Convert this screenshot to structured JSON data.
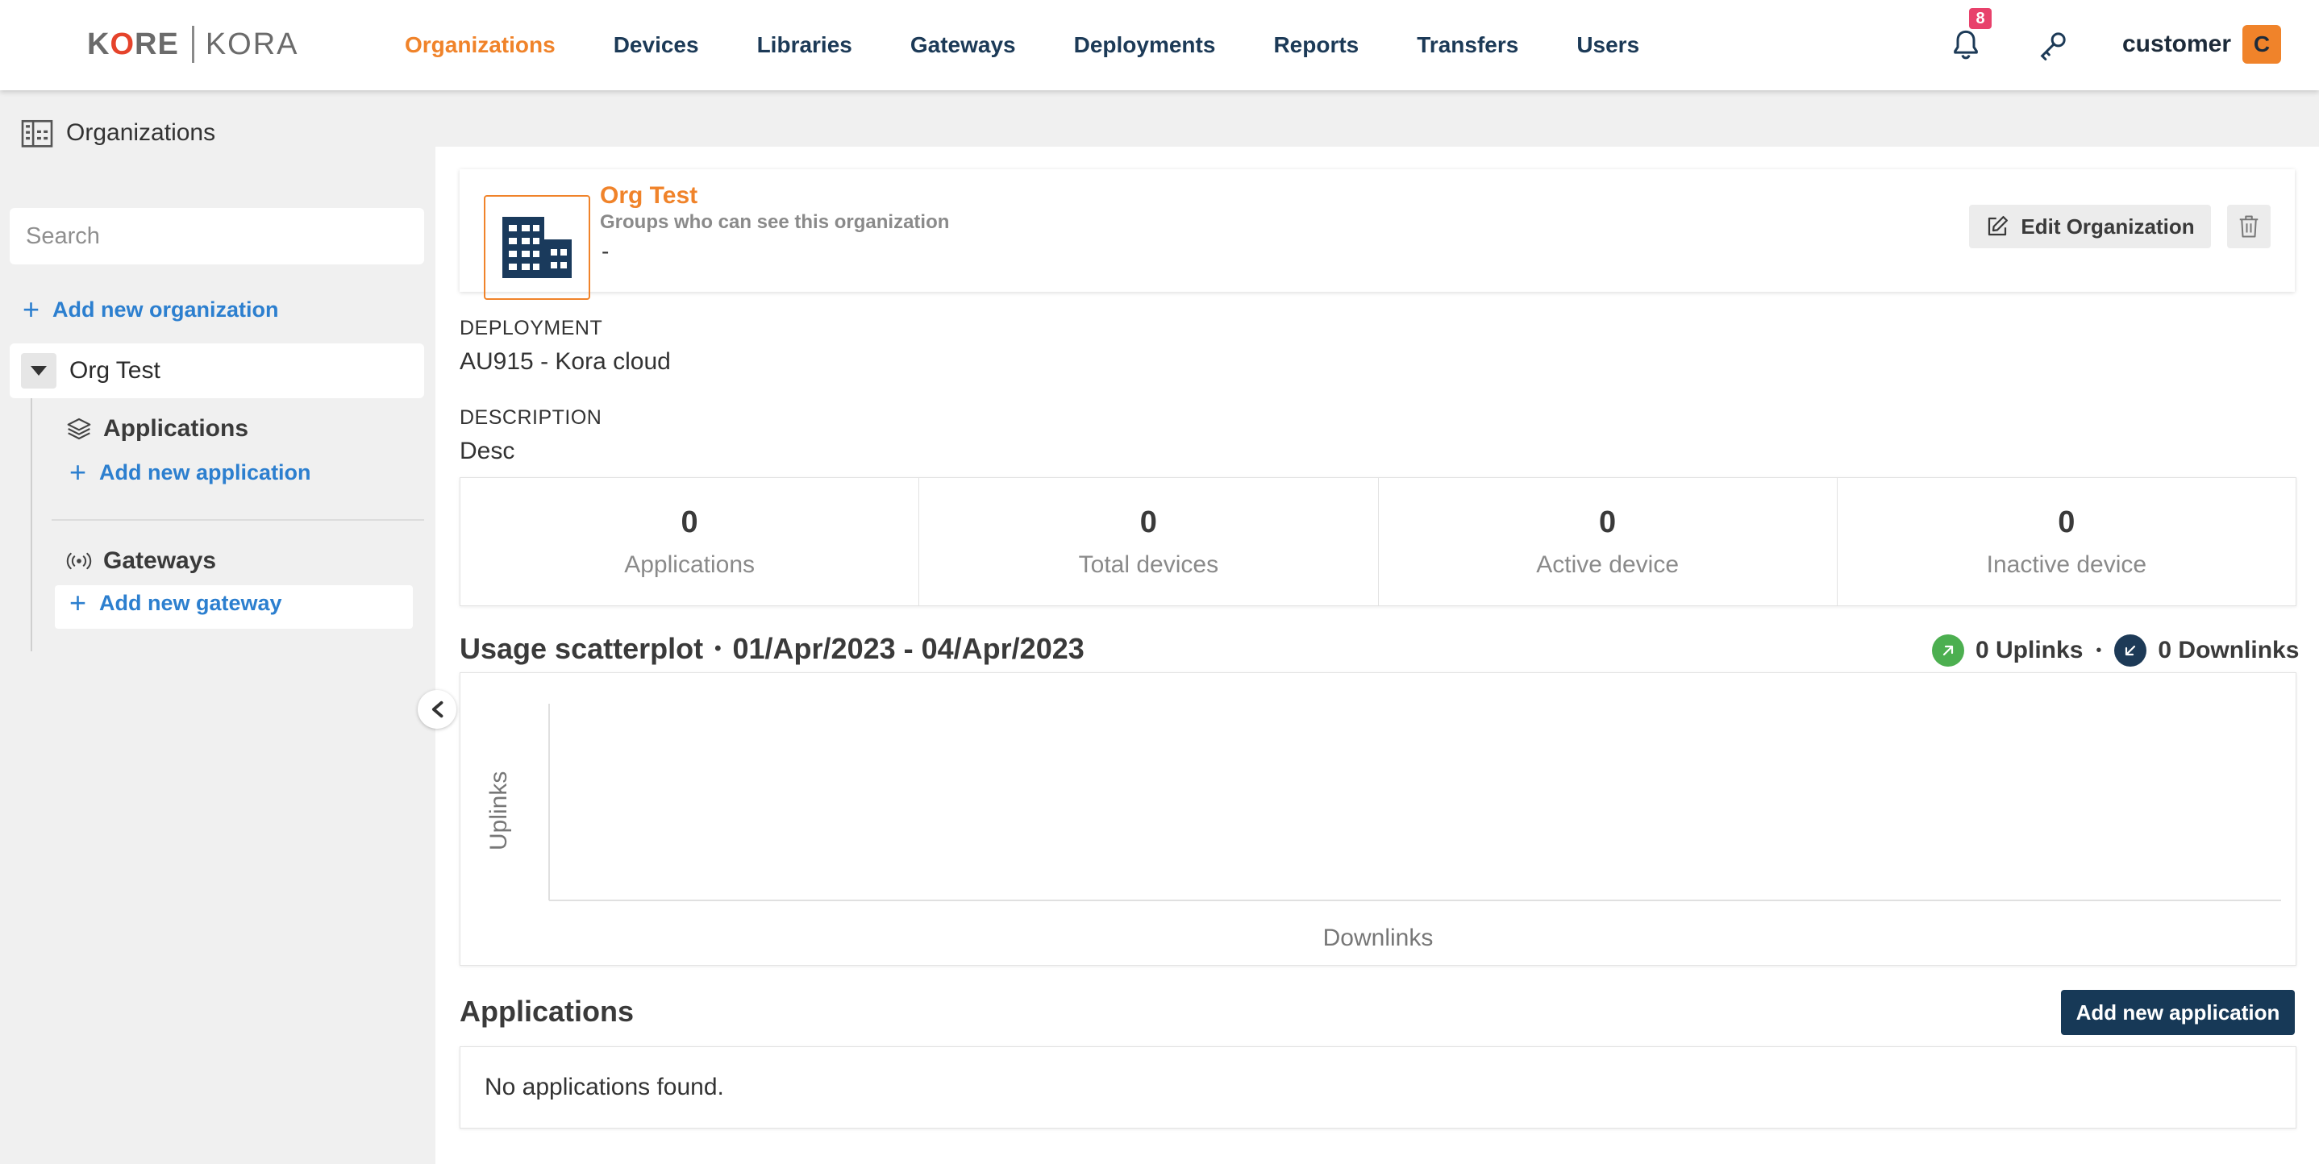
{
  "brand": {
    "left": "KORE",
    "right": "KORA"
  },
  "nav": {
    "items": [
      {
        "label": "Organizations",
        "active": true
      },
      {
        "label": "Devices"
      },
      {
        "label": "Libraries"
      },
      {
        "label": "Gateways"
      },
      {
        "label": "Deployments"
      },
      {
        "label": "Reports"
      },
      {
        "label": "Transfers"
      },
      {
        "label": "Users"
      }
    ],
    "notifications_count": "8",
    "username": "customer",
    "avatar_initial": "C"
  },
  "sidebar": {
    "title": "Organizations",
    "search_placeholder": "Search",
    "add_org_label": "Add new organization",
    "org_name": "Org Test",
    "applications_label": "Applications",
    "add_application_label": "Add new application",
    "gateways_label": "Gateways",
    "add_gateway_label": "Add new gateway"
  },
  "org": {
    "name": "Org Test",
    "groups_label": "Groups who can see this organization",
    "groups_value": "-",
    "edit_label": "Edit Organization",
    "deployment_label": "DEPLOYMENT",
    "deployment_value": "AU915 - Kora cloud",
    "description_label": "DESCRIPTION",
    "description_value": "Desc"
  },
  "stats": [
    {
      "value": "0",
      "label": "Applications"
    },
    {
      "value": "0",
      "label": "Total devices"
    },
    {
      "value": "0",
      "label": "Active device"
    },
    {
      "value": "0",
      "label": "Inactive device"
    }
  ],
  "usage": {
    "title": "Usage scatterplot",
    "range": "01/Apr/2023 - 04/Apr/2023",
    "uplinks": "0 Uplinks",
    "downlinks": "0 Downlinks",
    "uplink_color": "#4caf50",
    "downlink_color": "#1d3a57"
  },
  "chart_data": {
    "type": "scatter",
    "xlabel": "Downlinks",
    "ylabel": "Uplinks",
    "series": [],
    "grid": false
  },
  "applications": {
    "title": "Applications",
    "add_label": "Add new application",
    "empty_text": "No applications found."
  },
  "colors": {
    "accent": "#f0832a",
    "link": "#2c7fcf",
    "navy": "#173957"
  }
}
